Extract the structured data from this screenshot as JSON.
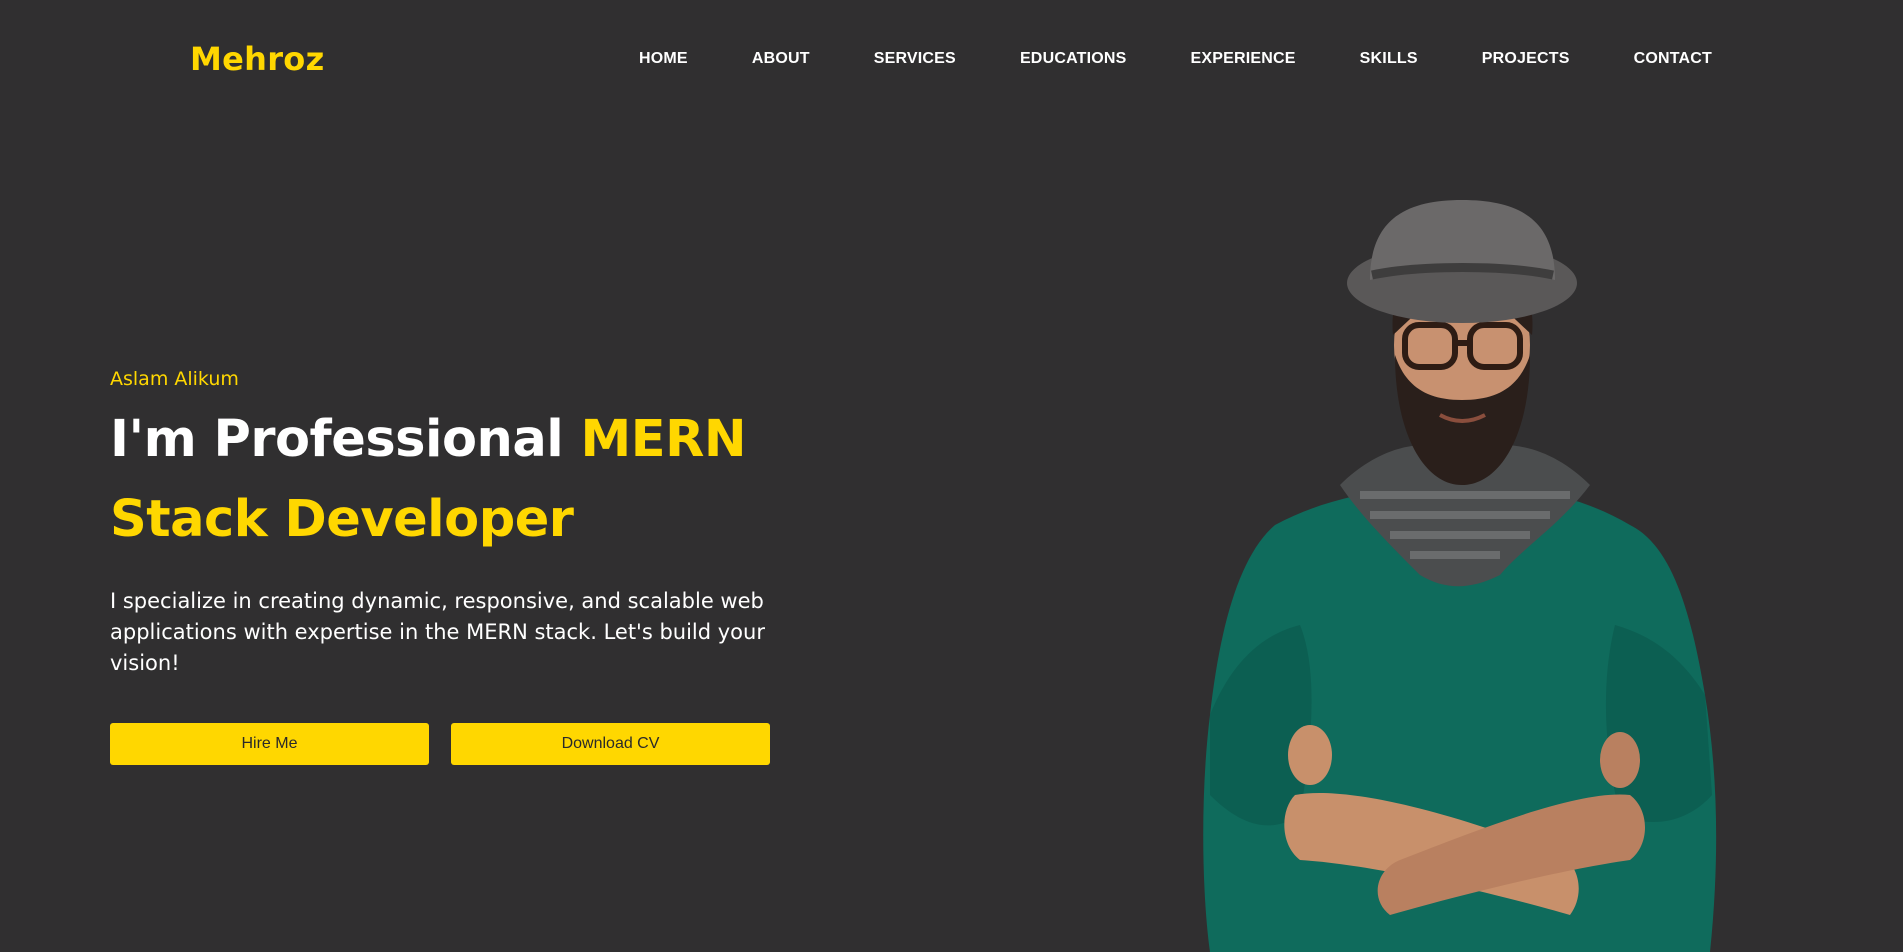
{
  "header": {
    "logo": "Mehroz",
    "nav": [
      {
        "label": "HOME"
      },
      {
        "label": "ABOUT"
      },
      {
        "label": "SERVICES"
      },
      {
        "label": "EDUCATIONS"
      },
      {
        "label": "EXPERIENCE"
      },
      {
        "label": "SKILLS"
      },
      {
        "label": "PROJECTS"
      },
      {
        "label": "CONTACT"
      }
    ]
  },
  "hero": {
    "greeting": "Aslam Alikum",
    "headline_part1": "I'm Professional ",
    "headline_part2": "MERN",
    "headline_part3": "Stack Developer",
    "description": "I specialize in creating dynamic, responsive, and scalable web applications with expertise in the MERN stack. Let's build your vision!",
    "buttons": {
      "hire": "Hire Me",
      "download": "Download CV"
    }
  },
  "colors": {
    "background": "#302f30",
    "accent": "#ffd700",
    "text": "#ffffff"
  }
}
